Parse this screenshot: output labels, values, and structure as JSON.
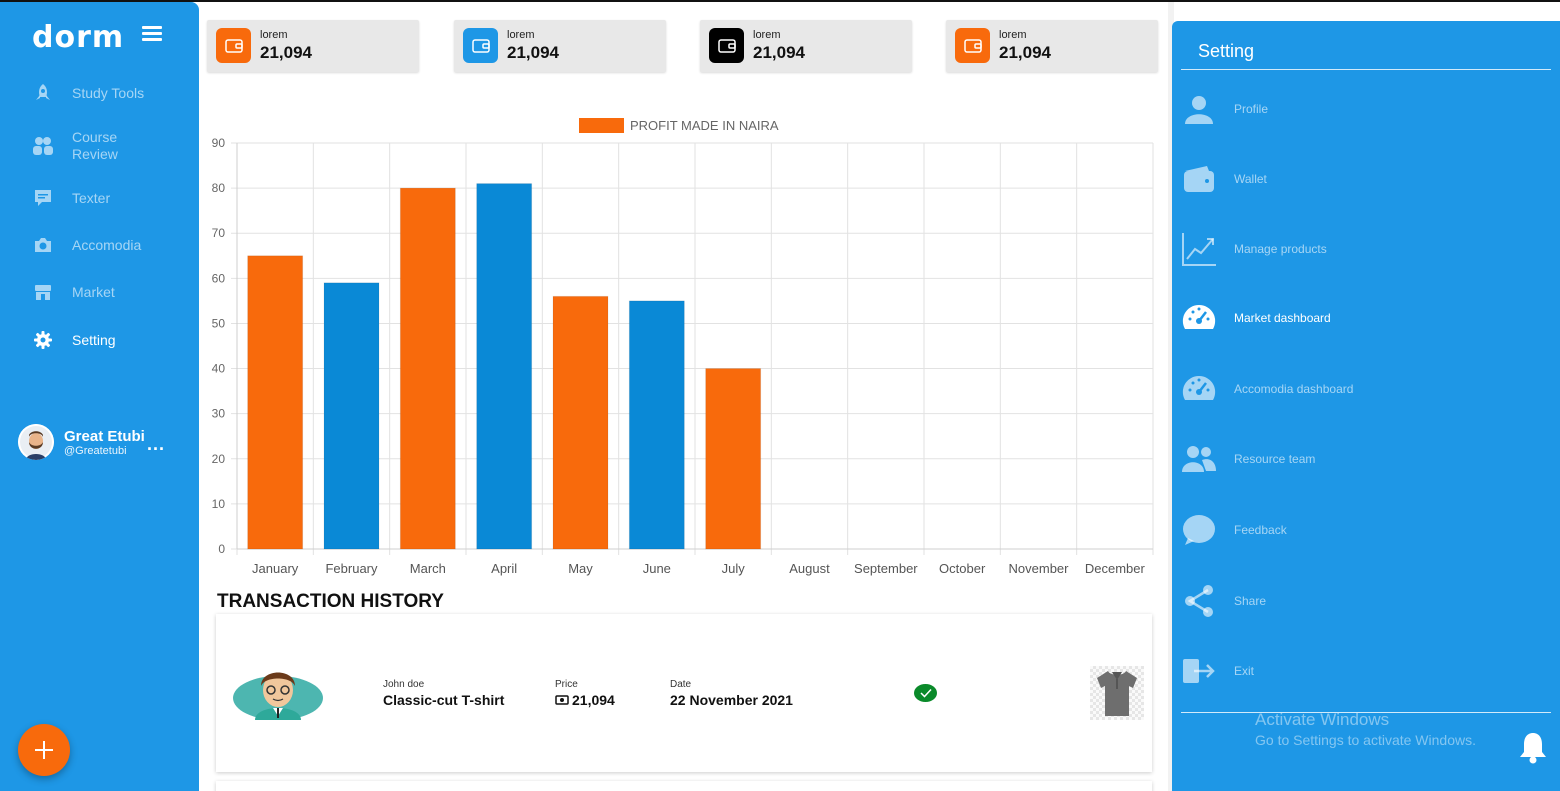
{
  "app": {
    "logo": "dorm"
  },
  "sidebar": {
    "items": [
      {
        "label": "Study Tools",
        "icon": "rocket-icon"
      },
      {
        "label": "Course Review",
        "icon": "users-icon"
      },
      {
        "label": "Texter",
        "icon": "message-icon"
      },
      {
        "label": "Accomodia",
        "icon": "camera-icon"
      },
      {
        "label": "Market",
        "icon": "store-icon"
      },
      {
        "label": "Setting",
        "icon": "gear-icon"
      }
    ],
    "profile": {
      "name": "Great Etubi",
      "handle": "@Greatetubi",
      "more": "..."
    }
  },
  "cards": [
    {
      "label": "lorem",
      "value": "21,094",
      "color": "#f86a0c"
    },
    {
      "label": "lorem",
      "value": "21,094",
      "color": "#1e97e6"
    },
    {
      "label": "lorem",
      "value": "21,094",
      "color": "#000000"
    },
    {
      "label": "lorem",
      "value": "21,094",
      "color": "#f86a0c"
    }
  ],
  "chart_data": {
    "type": "bar",
    "categories": [
      "January",
      "February",
      "March",
      "April",
      "May",
      "June",
      "July",
      "August",
      "September",
      "October",
      "November",
      "December"
    ],
    "series": [
      {
        "name": "PROFIT MADE IN NAIRA",
        "values": [
          65,
          59,
          80,
          81,
          56,
          55,
          40,
          null,
          null,
          null,
          null,
          null
        ]
      }
    ],
    "bar_colors": [
      "#f86a0c",
      "#0a89d6",
      "#f86a0c",
      "#0a89d6",
      "#f86a0c",
      "#0a89d6",
      "#f86a0c"
    ],
    "yticks": [
      0,
      10,
      20,
      30,
      40,
      50,
      60,
      70,
      80,
      90
    ],
    "ylim": [
      0,
      90
    ],
    "grid": true,
    "legend": "top-center"
  },
  "transactions": {
    "title": "TRANSACTION HISTORY",
    "rows": [
      {
        "name": "John doe",
        "product": "Classic-cut T-shirt",
        "price_label": "Price",
        "price": "21,094",
        "date_label": "Date",
        "date": "22 November 2021",
        "status": "completed"
      }
    ]
  },
  "settings_panel": {
    "title": "Setting",
    "items": [
      {
        "label": "Profile",
        "icon": "user-icon"
      },
      {
        "label": "Wallet",
        "icon": "wallet-icon"
      },
      {
        "label": "Manage products",
        "icon": "trend-chart-icon"
      },
      {
        "label": "Market dashboard",
        "icon": "speedometer-icon"
      },
      {
        "label": "Accomodia dashboard",
        "icon": "speedometer-icon"
      },
      {
        "label": "Resource team",
        "icon": "team-icon"
      },
      {
        "label": "Feedback",
        "icon": "chat-bubble-icon"
      },
      {
        "label": "Share",
        "icon": "share-icon"
      },
      {
        "label": "Exit",
        "icon": "exit-icon"
      }
    ],
    "active": "Market dashboard"
  },
  "watermark": {
    "line1": "Activate Windows",
    "line2": "Go to Settings to activate Windows."
  }
}
